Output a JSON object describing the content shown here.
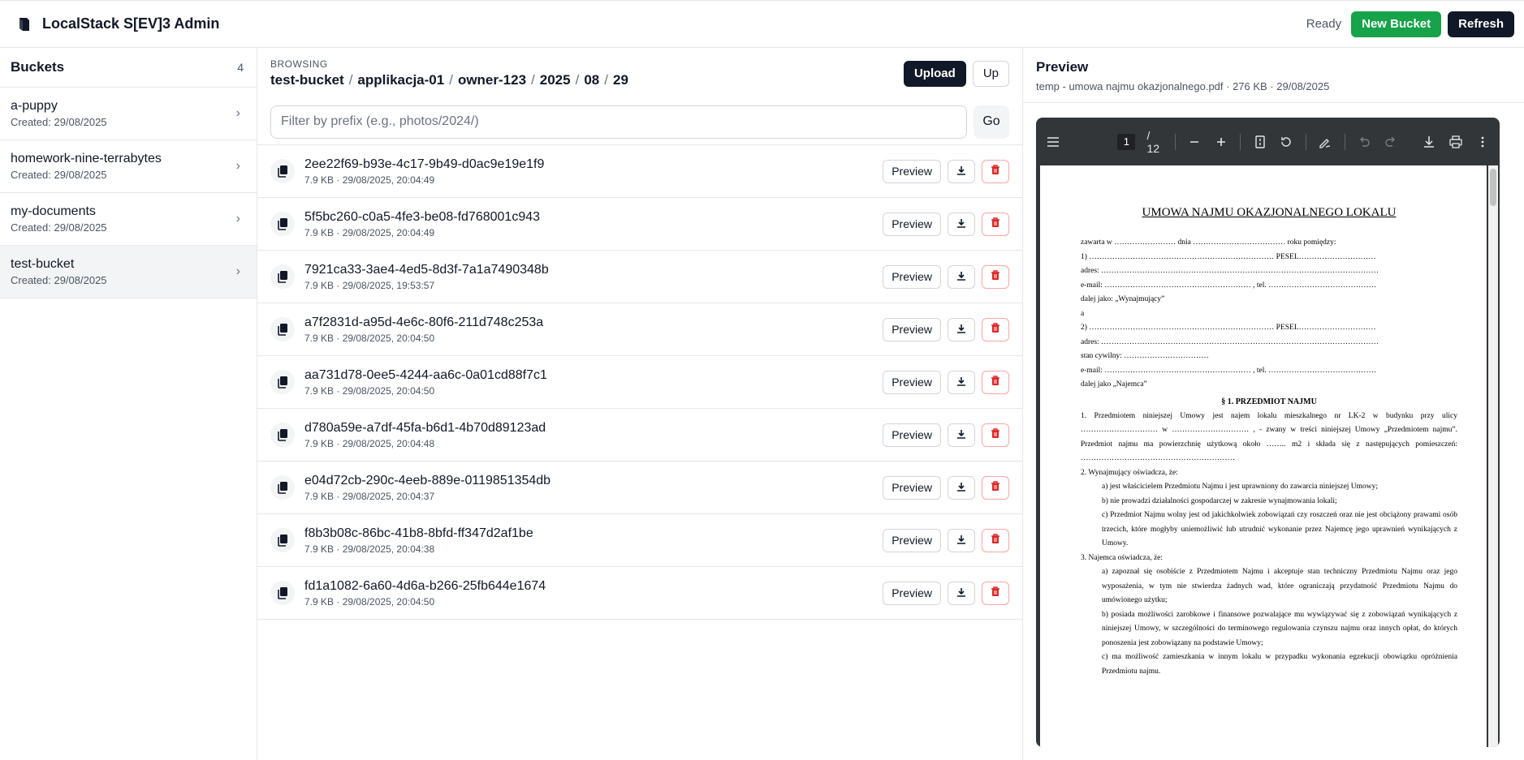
{
  "app": {
    "title": "LocalStack S[EV]3 Admin",
    "status": "Ready",
    "new_bucket_label": "New Bucket",
    "refresh_label": "Refresh",
    "accent_green": "#16a34a",
    "accent_dark": "#111827"
  },
  "sidebar": {
    "title": "Buckets",
    "count": "4",
    "buckets": [
      {
        "name": "a-puppy",
        "created": "Created: 29/08/2025"
      },
      {
        "name": "homework-nine-terrabytes",
        "created": "Created: 29/08/2025"
      },
      {
        "name": "my-documents",
        "created": "Created: 29/08/2025"
      },
      {
        "name": "test-bucket",
        "created": "Created: 29/08/2025"
      }
    ]
  },
  "browse": {
    "label": "BROWSING",
    "crumbs": [
      "test-bucket",
      "applikacja-01",
      "owner-123",
      "2025",
      "08",
      "29"
    ],
    "separator": "/",
    "upload_label": "Upload",
    "up_label": "Up",
    "filter_placeholder": "Filter by prefix (e.g., photos/2024/)",
    "filter_value": "",
    "go_label": "Go",
    "preview_label": "Preview",
    "files": [
      {
        "name": "2ee22f69-b93e-4c17-9b49-d0ac9e19e1f9",
        "meta": "7.9 KB · 29/08/2025, 20:04:49"
      },
      {
        "name": "5f5bc260-c0a5-4fe3-be08-fd768001c943",
        "meta": "7.9 KB · 29/08/2025, 20:04:49"
      },
      {
        "name": "7921ca33-3ae4-4ed5-8d3f-7a1a7490348b",
        "meta": "7.9 KB · 29/08/2025, 19:53:57"
      },
      {
        "name": "a7f2831d-a95d-4e6c-80f6-211d748c253a",
        "meta": "7.9 KB · 29/08/2025, 20:04:50"
      },
      {
        "name": "aa731d78-0ee5-4244-aa6c-0a01cd88f7c1",
        "meta": "7.9 KB · 29/08/2025, 20:04:50"
      },
      {
        "name": "d780a59e-a7df-45fa-b6d1-4b70d89123ad",
        "meta": "7.9 KB · 29/08/2025, 20:04:48"
      },
      {
        "name": "e04d72cb-290c-4eeb-889e-0119851354db",
        "meta": "7.9 KB · 29/08/2025, 20:04:37"
      },
      {
        "name": "f8b3b08c-86bc-41b8-8bfd-ff347d2af1be",
        "meta": "7.9 KB · 29/08/2025, 20:04:38"
      },
      {
        "name": "fd1a1082-6a60-4d6a-b266-25fb644e1674",
        "meta": "7.9 KB · 29/08/2025, 20:04:50"
      }
    ]
  },
  "preview": {
    "title": "Preview",
    "meta": "temp - umowa najmu okazjonalnego.pdf · 276 KB · 29/08/2025",
    "viewer": {
      "page_current": "1",
      "page_total": "/ 12"
    },
    "document": {
      "title": "UMOWA NAJMU OKAZJONALNEGO LOKALU",
      "lines": [
        "zawarta w …………………… dnia ……………………………… roku pomiędzy:",
        "1)        ……………………………………………………………… PESEL…………………………",
        "adres: ………………………………………………………………………………………………",
        "e-mail: ………………………………………………… , tel. ……………………………………",
        "dalej jako: „Wynajmujący”",
        "a",
        "2)        ……………………………………………………………… PESEL…………………………",
        "adres: ………………………………………………………………………………………………",
        "stan cywilny: ……………………………",
        "e-mail: ………………………………………………… , tel. ……………………………………",
        "dalej jako „Najemca”"
      ],
      "section": "§ 1. PRZEDMIOT NAJMU",
      "paragraphs": [
        {
          "cls": "doc-para",
          "text": "1.     Przedmiotem niniejszej Umowy jest najem lokalu mieszkalnego nr LK-2 w budynku przy ulicy ………………………… w ………………………… , - zwany w treści niniejszej Umowy „Przedmiotem najmu”. Przedmiot najmu ma powierzchnię użytkową około …….. m2 i składa się z następujących pomieszczeń: ……………………………………………………"
        },
        {
          "cls": "doc-para",
          "text": "2.     Wynajmujący oświadcza, że:"
        },
        {
          "cls": "doc-para ind1",
          "text": "a)   jest właścicielem Przedmiotu Najmu i jest uprawniony do zawarcia niniejszej Umowy;"
        },
        {
          "cls": "doc-para ind1",
          "text": "b)   nie prowadzi działalności gospodarczej w zakresie wynajmowania lokali;"
        },
        {
          "cls": "doc-para ind1",
          "text": "c)   Przedmiot Najmu wolny jest od jakichkolwiek zobowiązań czy roszczeń oraz nie jest obciążony prawami osób trzecich, które mogłyby uniemożliwić lub utrudnić wykonanie przez Najemcę jego uprawnień wynikających z Umowy."
        },
        {
          "cls": "doc-para",
          "text": "3.   Najemca oświadcza, że:"
        },
        {
          "cls": "doc-para ind1",
          "text": "a)   zapoznał się osobiście z Przedmiotem Najmu i akceptuje stan techniczny Przedmiotu Najmu oraz jego wyposażenia, w tym nie stwierdza żadnych wad, które ograniczają przydatność Przedmiotu Najmu do umówionego użytku;"
        },
        {
          "cls": "doc-para ind1",
          "text": "b)   posiada możliwości zarobkowe i finansowe pozwalające mu wywiązywać się z zobowiązań wynikających z niniejszej Umowy, w szczególności do terminowego regulowania czynszu najmu oraz innych opłat, do których ponoszenia jest zobowiązany na podstawie Umowy;"
        },
        {
          "cls": "doc-para ind1",
          "text": "c)   ma możliwość zamieszkania w innym lokalu w przypadku wykonania egzekucji obowiązku opróżnienia Przedmiotu najmu."
        }
      ]
    }
  }
}
